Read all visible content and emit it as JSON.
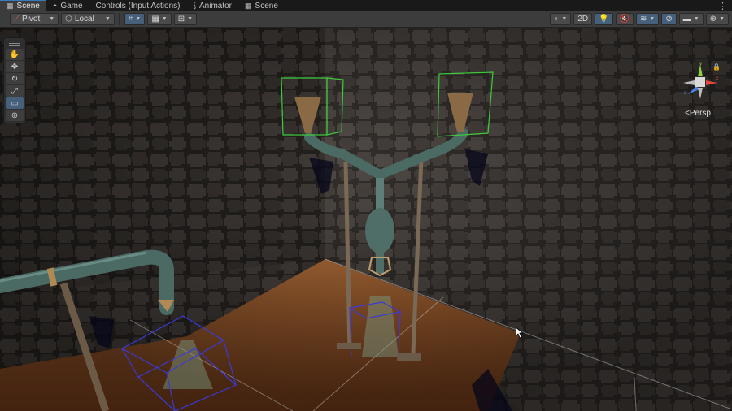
{
  "tabs": [
    {
      "label": "Scene",
      "icon": "grid-icon",
      "active": true
    },
    {
      "label": "Game",
      "icon": "gamepad-icon",
      "active": false
    },
    {
      "label": "Controls (Input Actions)",
      "icon": "",
      "active": false
    },
    {
      "label": "Animator",
      "icon": "animator-icon",
      "active": false
    },
    {
      "label": "Scene",
      "icon": "grid-icon",
      "active": false
    }
  ],
  "toolbar": {
    "pivot_label": "Pivot",
    "local_label": "Local",
    "mode_2d_label": "2D"
  },
  "tools": [
    "hand-tool",
    "move-tool",
    "rotate-tool",
    "scale-tool",
    "rect-tool",
    "transform-tool"
  ],
  "active_tool": "rect-tool",
  "gizmo": {
    "projection_label": "Persp",
    "axes": {
      "y": "y",
      "x": "x",
      "z": "z"
    }
  },
  "colors": {
    "selection_green": "#3ec93e",
    "selection_blue": "#3a3ad6",
    "active_blue": "#46607c",
    "wall": "#37322f",
    "floor": "#a0582a"
  }
}
